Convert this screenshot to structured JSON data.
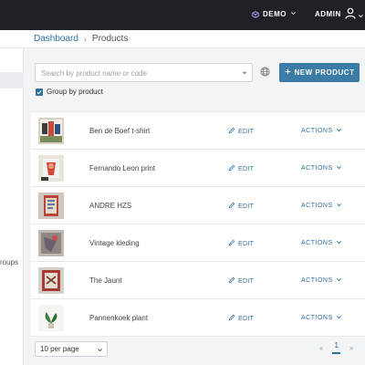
{
  "topbar": {
    "workspace_label": "DEMO",
    "user_label": "ADMIN"
  },
  "breadcrumb": {
    "root": "Dashboard",
    "separator": "›",
    "current": "Products"
  },
  "sidebar": {
    "partial_text": "roups"
  },
  "search": {
    "placeholder": "Search by product name or code",
    "value": ""
  },
  "toolbar": {
    "new_product_label": "NEW PRODUCT",
    "group_by_label": "Group by product",
    "group_by_checked": true
  },
  "products": [
    {
      "name": "Ben de Boef t-shirt",
      "edit_label": "EDIT",
      "actions_label": "ACTIONS"
    },
    {
      "name": "Fernando Leon print",
      "edit_label": "EDIT",
      "actions_label": "ACTIONS"
    },
    {
      "name": "ANDRE HZS",
      "edit_label": "EDIT",
      "actions_label": "ACTIONS"
    },
    {
      "name": "Vintage kleding",
      "edit_label": "EDIT",
      "actions_label": "ACTIONS"
    },
    {
      "name": "The Jaunt",
      "edit_label": "EDIT",
      "actions_label": "ACTIONS"
    },
    {
      "name": "Pannenkoek plant",
      "edit_label": "EDIT",
      "actions_label": "ACTIONS"
    }
  ],
  "pagination": {
    "per_page_label": "10 per page",
    "prev": "«",
    "current_page": "1",
    "next": "»"
  },
  "colors": {
    "topbar": "#1f2126",
    "accent": "#3a7ca5",
    "link": "#2f6f9e",
    "demo_icon": "#a89cf0"
  },
  "icons": {
    "workspace": "cube-icon",
    "user": "user-icon",
    "globe": "globe-icon",
    "add": "plus-icon",
    "edit": "pencil-icon",
    "actions": "chevron-down-icon"
  }
}
